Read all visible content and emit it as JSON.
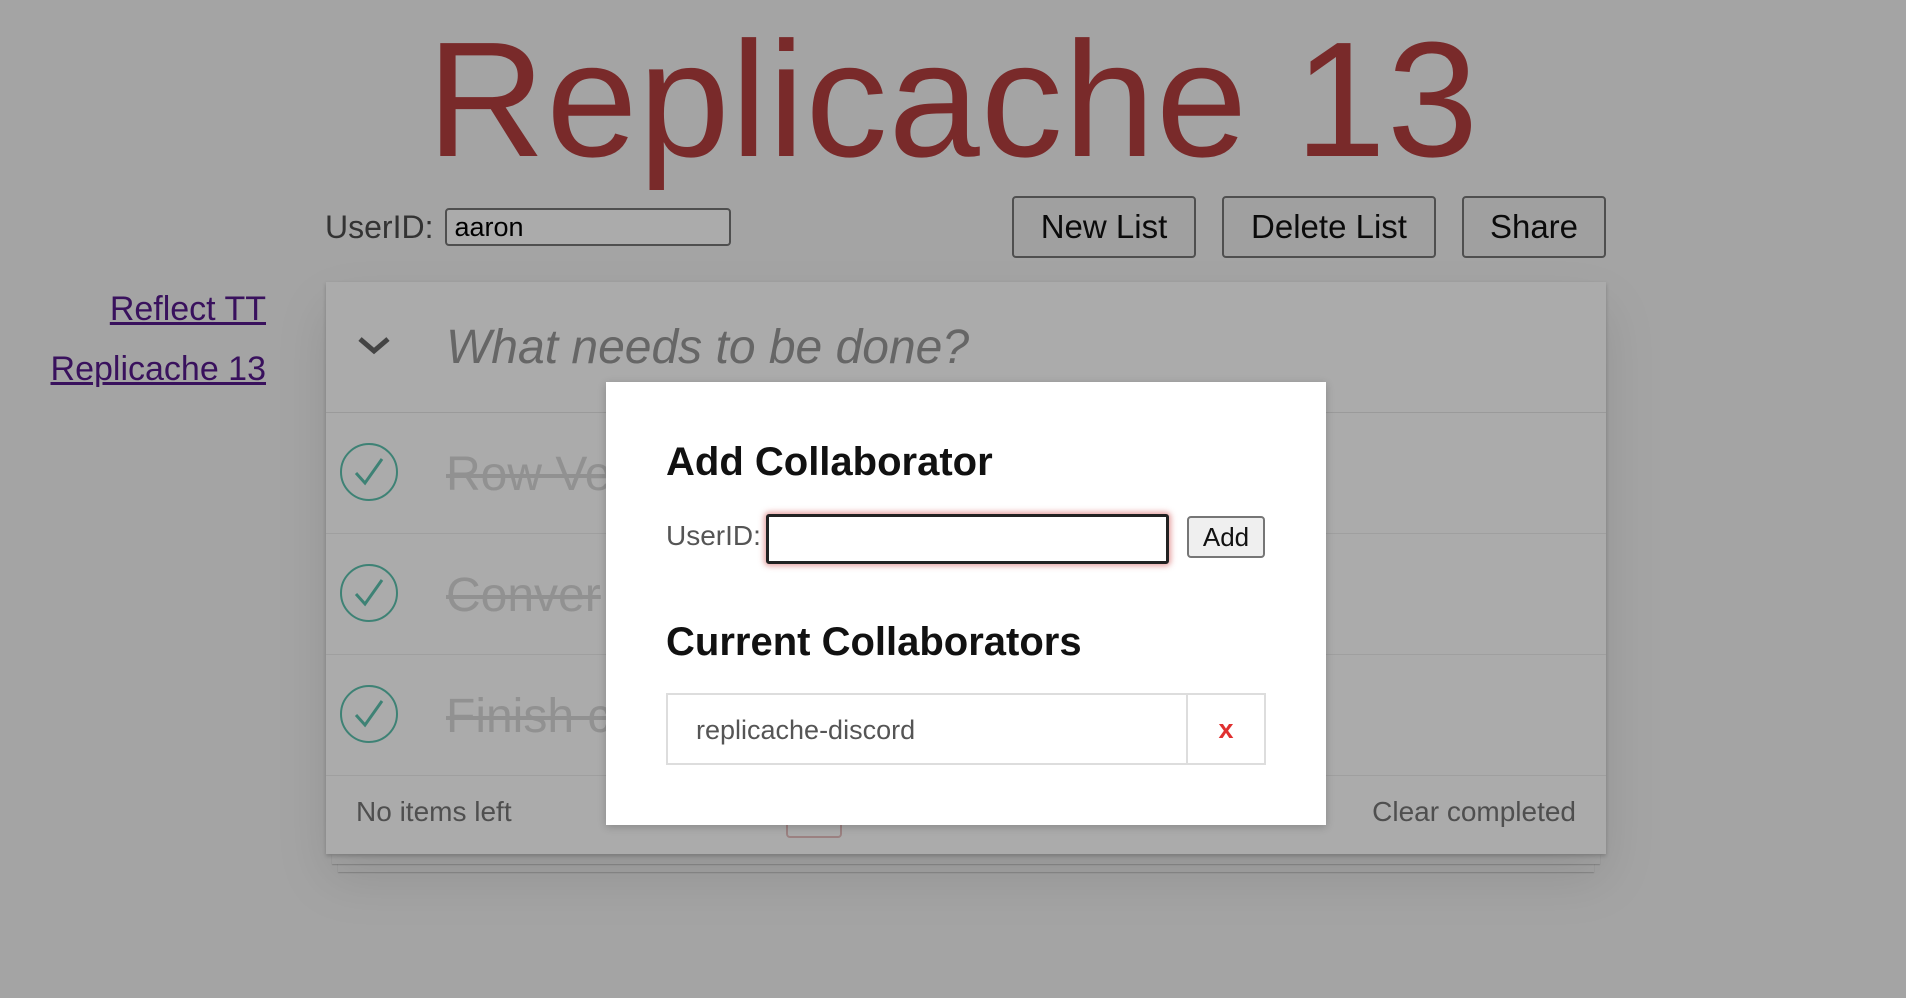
{
  "app": {
    "title": "Replicache 13"
  },
  "user_bar": {
    "label": "UserID:",
    "value": "aaron"
  },
  "toolbar": {
    "new_list": "New List",
    "delete_list": "Delete List",
    "share": "Share"
  },
  "lists_nav": [
    {
      "label": "Reflect TT"
    },
    {
      "label": "Replicache 13"
    }
  ],
  "todo": {
    "toggle_all_icon": "chevron-down-icon",
    "new_placeholder": "What needs to be done?",
    "items": [
      {
        "text": "Row Ve",
        "completed": true
      },
      {
        "text": "Conver",
        "completed": true
      },
      {
        "text": "Finish c",
        "completed": true
      }
    ],
    "footer": {
      "count": "No items left",
      "clear": "Clear completed"
    }
  },
  "modal": {
    "title": "Add Collaborator",
    "userid_label": "UserID:",
    "userid_value": "",
    "add_label": "Add",
    "current_title": "Current Collaborators",
    "collaborators": [
      {
        "name": "replicache-discord",
        "remove_label": "x"
      }
    ]
  },
  "colors": {
    "title": "#af2f2f",
    "check": "#5dc2af",
    "remove": "#e03030",
    "link": "#551a8b"
  }
}
